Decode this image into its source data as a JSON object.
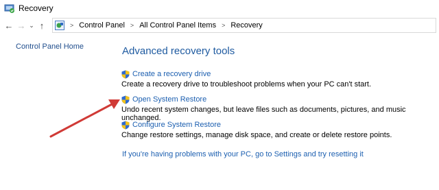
{
  "window": {
    "title": "Recovery"
  },
  "address": {
    "crumbs": [
      "Control Panel",
      "All Control Panel Items",
      "Recovery"
    ]
  },
  "sidebar": {
    "home_link": "Control Panel Home"
  },
  "main": {
    "heading": "Advanced recovery tools",
    "items": [
      {
        "label": "Create a recovery drive",
        "desc": "Create a recovery drive to troubleshoot problems when your PC can't start."
      },
      {
        "label": "Open System Restore",
        "desc": "Undo recent system changes, but leave files such as documents, pictures, and music unchanged."
      },
      {
        "label": "Configure System Restore",
        "desc": "Change restore settings, manage disk space, and create or delete restore points."
      }
    ],
    "reset_link": "If you're having problems with your PC, go to Settings and try resetting it"
  },
  "colors": {
    "link": "#1c5fb0",
    "heading": "#1e5aa0",
    "arrow": "#d03a36"
  },
  "icons": {
    "window": "recovery-icon",
    "shield": "uac-shield-icon"
  }
}
